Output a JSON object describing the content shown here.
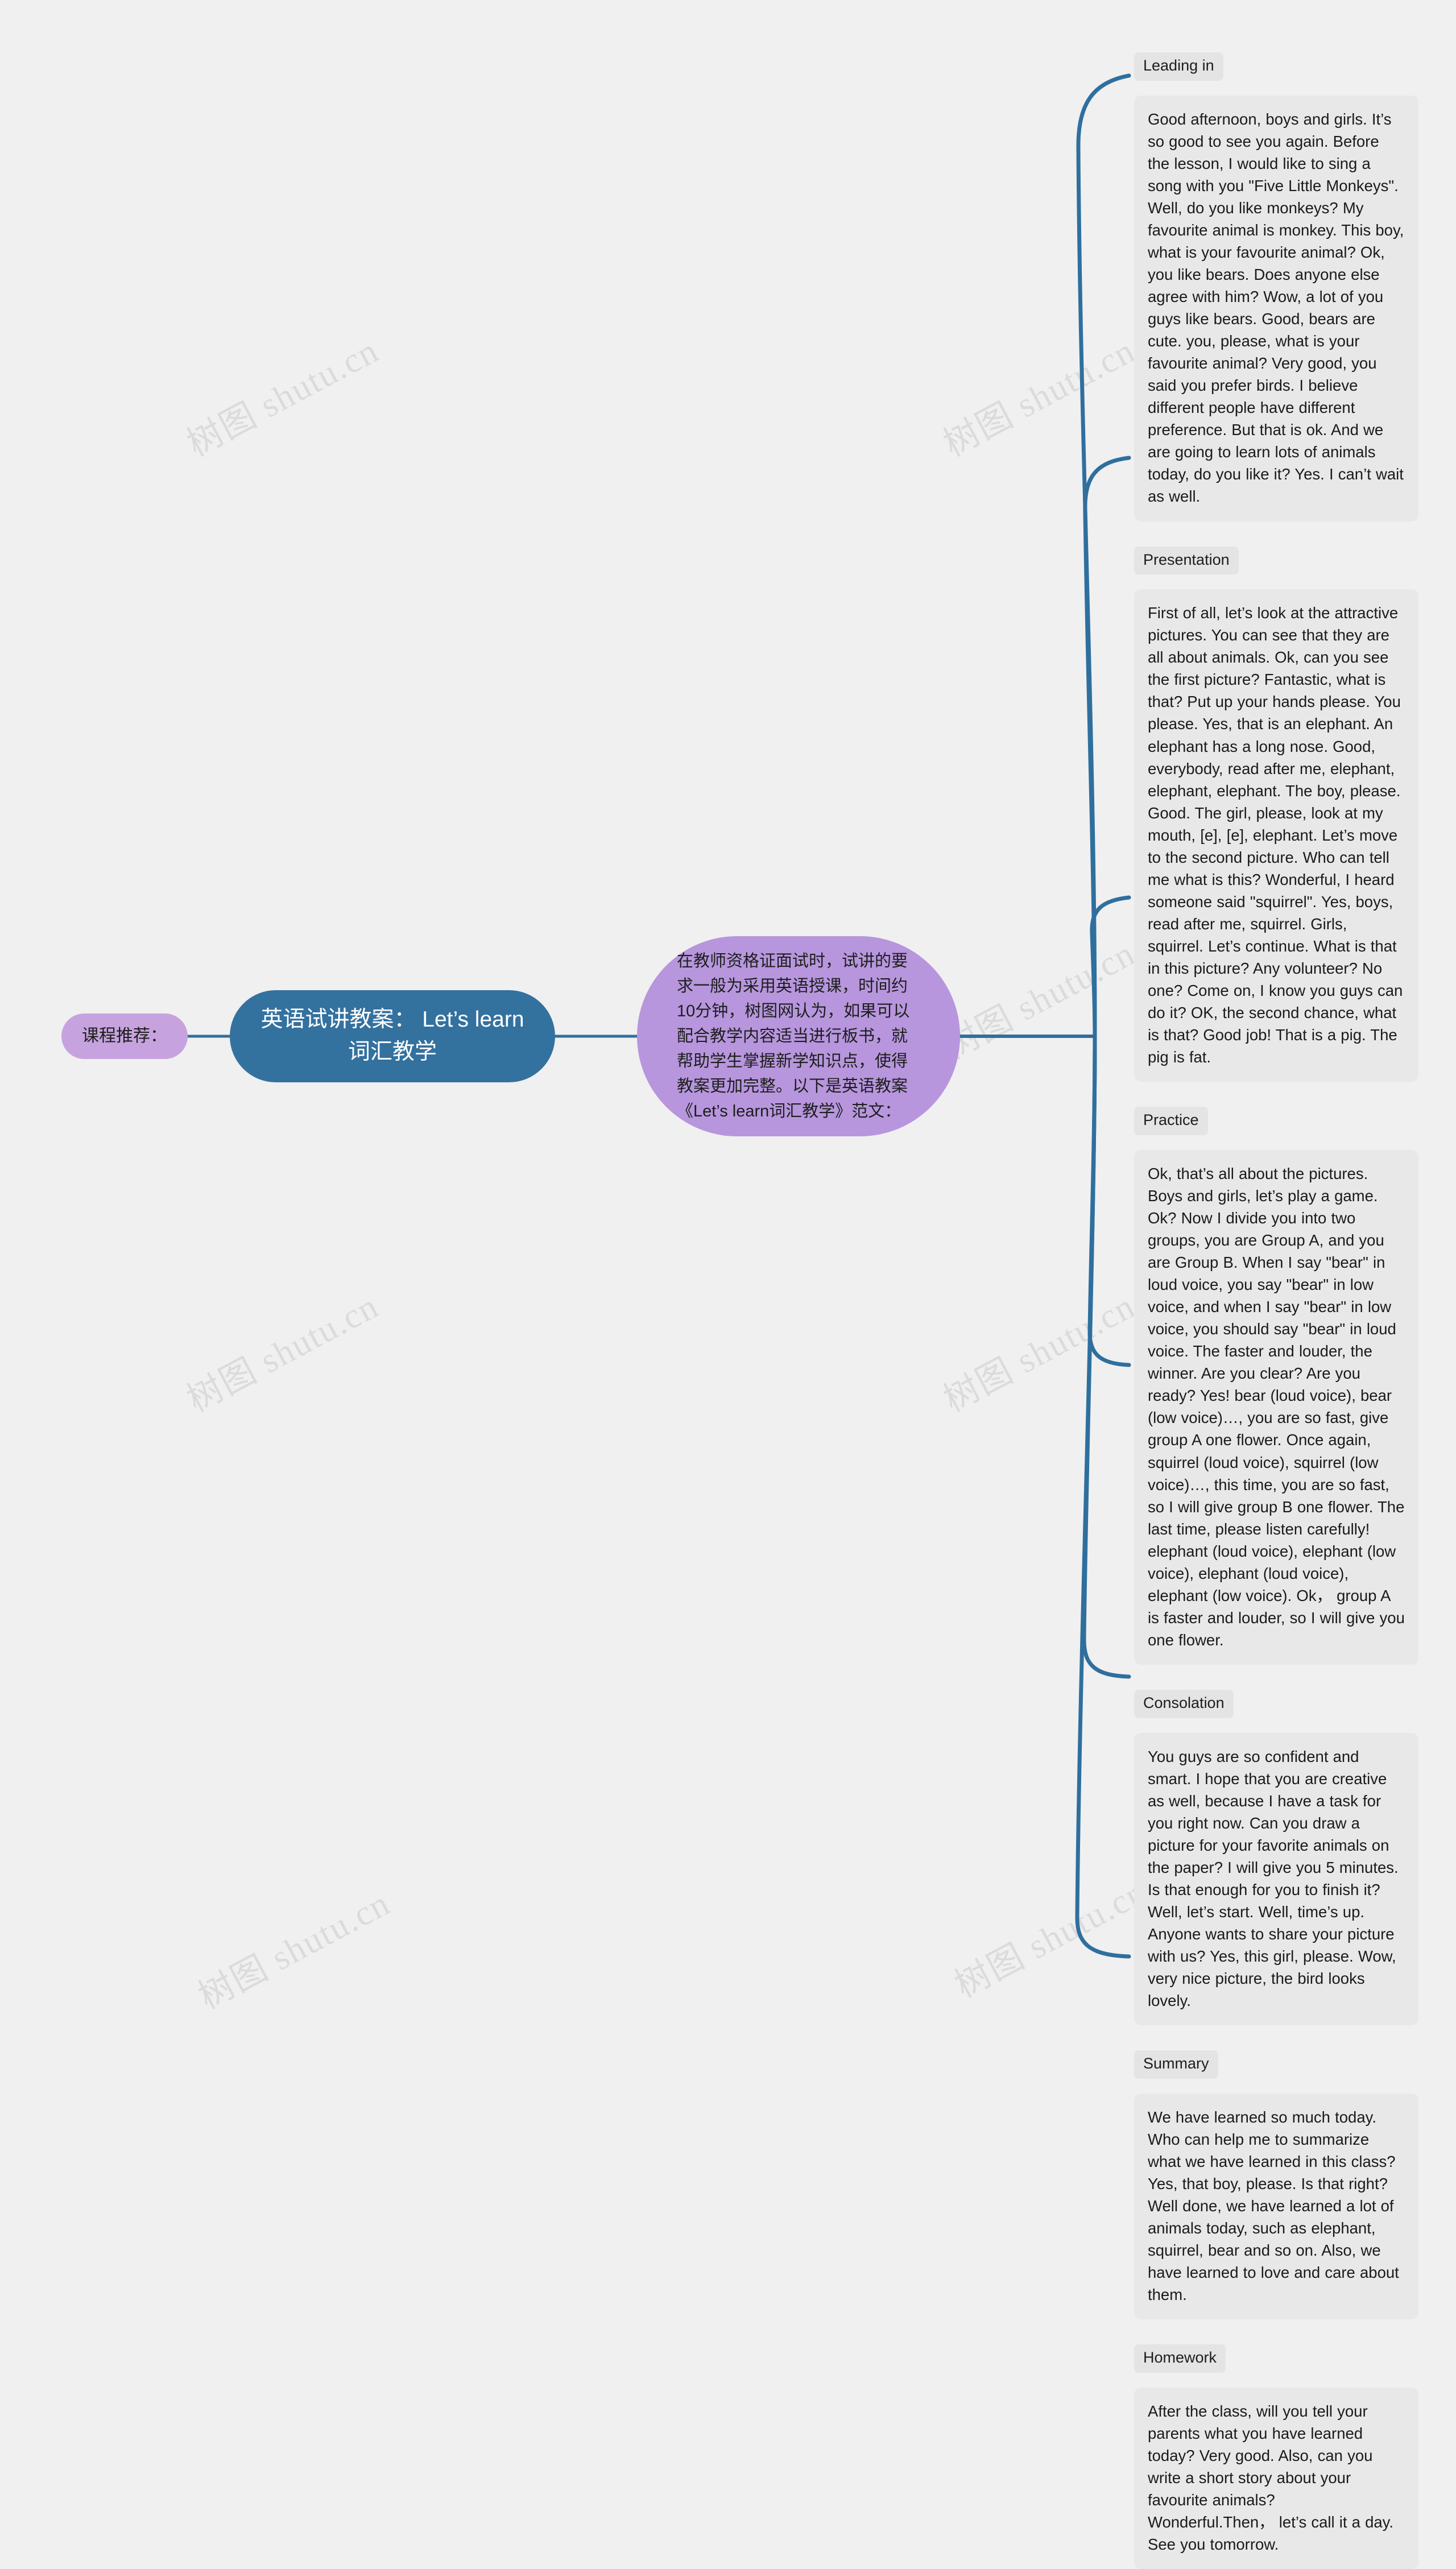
{
  "root": {
    "title": "英语试讲教案： Let’s learn词汇教学"
  },
  "left_branch": {
    "label": "课程推荐："
  },
  "intro_node": {
    "text": "在教师资格证面试时，试讲的要求一般为采用英语授课，时间约10分钟，树图网认为，如果可以配合教学内容适当进行板书，就帮助学生掌握新学知识点，使得教案更加完整。以下是英语教案《Let’s learn词汇教学》范文："
  },
  "sections": [
    {
      "label": "Leading in",
      "body": "Good afternoon, boys and girls. It’s so good to see you again. Before the lesson, I would like to sing a song with you \"Five Little Monkeys\". Well, do you like monkeys? My favourite animal is monkey. This boy, what is your favourite animal? Ok, you like bears. Does anyone else agree with him? Wow, a lot of you guys like bears. Good, bears are cute. you, please, what is your favourite animal? Very good, you said you prefer birds. I believe different people have different preference. But that is ok. And we are going to learn lots of animals today, do you like it? Yes. I can’t wait as well."
    },
    {
      "label": "Presentation",
      "body": "First of all, let’s look at the attractive pictures. You can see that they are all about animals. Ok, can you see the first picture? Fantastic, what is that? Put up your hands please. You please. Yes, that is an elephant. An elephant has a long nose. Good, everybody, read after me, elephant, elephant, elephant. The boy, please. Good. The girl, please, look at my mouth, [e], [e], elephant. Let’s move to the second picture. Who can tell me what is this? Wonderful, I heard someone said \"squirrel\". Yes, boys, read after me, squirrel. Girls, squirrel. Let’s continue. What is that in this picture? Any volunteer? No one? Come on, I know you guys can do it? OK, the second chance, what is that? Good job! That is a pig. The pig is fat."
    },
    {
      "label": "Practice",
      "body": "Ok, that’s all about the pictures. Boys and girls, let’s play a game. Ok? Now I divide you into two groups, you are Group A, and you are Group B. When I say \"bear\" in loud voice, you say \"bear\" in low voice, and when I say \"bear\" in low voice, you should say \"bear\" in loud voice. The faster and louder, the winner. Are you clear? Are you ready? Yes! bear (loud voice), bear (low voice)…, you are so fast, give group A one flower. Once again, squirrel (loud voice), squirrel (low voice)…, this time, you are so fast, so I will give group B one flower. The last time, please listen carefully! elephant (loud voice), elephant (low voice), elephant (loud voice), elephant (low voice). Ok， group A is faster and louder, so I will give you one flower."
    },
    {
      "label": "Consolation",
      "body": "You guys are so confident and smart. I hope that you are creative as well, because I have a task for you right now. Can you draw a picture for your favorite animals on the paper? I will give you 5 minutes. Is that enough for you to finish it? Well, let’s start. Well, time’s up. Anyone wants to share your picture with us? Yes, this girl, please. Wow, very nice picture, the bird looks lovely."
    },
    {
      "label": "Summary",
      "body": "We have learned so much today. Who can help me to summarize what we have learned in this class? Yes, that boy, please. Is that right? Well done, we have learned a lot of animals today, such as elephant, squirrel, bear and so on. Also, we have learned to love and care about them."
    },
    {
      "label": "Homework",
      "body": "After the class, will you tell your parents what you have learned today? Very good. Also, can you write a short story about your favourite animals? Wonderful.Then， let’s call it a day. See you tomorrow."
    }
  ],
  "watermark": {
    "text": "树图 shutu.cn"
  },
  "colors": {
    "canvas": "#f0f0f0",
    "root_node": "#33719f",
    "purple_node": "#b796dd",
    "purple_small": "#c6a3de",
    "connector": "#2f6f9e",
    "card_bg": "#e8e8e8",
    "label_bg": "#e4e4e4"
  }
}
